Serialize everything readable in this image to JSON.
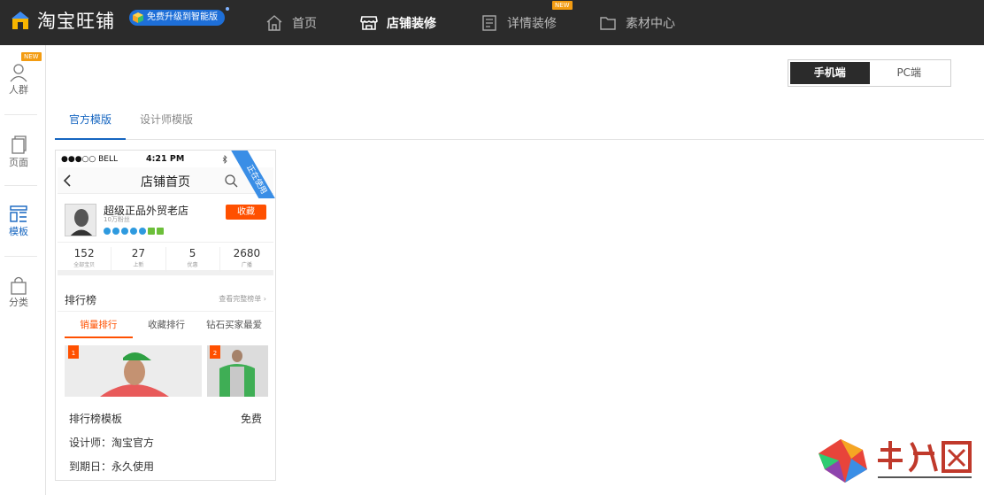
{
  "app": {
    "logo_text": "淘宝旺铺",
    "upgrade_label": "免费升级到智能版"
  },
  "nav": {
    "items": [
      {
        "label": "首页",
        "icon": "home-icon"
      },
      {
        "label": "店铺装修",
        "icon": "store-icon",
        "active": true
      },
      {
        "label": "详情装修",
        "icon": "document-icon",
        "badge": "NEW"
      },
      {
        "label": "素材中心",
        "icon": "folder-icon"
      }
    ]
  },
  "sidebar": {
    "items": [
      {
        "label": "人群",
        "icon": "person-icon",
        "badge": "NEW"
      },
      {
        "label": "页面",
        "icon": "page-icon"
      },
      {
        "label": "模板",
        "icon": "template-icon",
        "active": true
      },
      {
        "label": "分类",
        "icon": "bag-icon"
      }
    ]
  },
  "device_toggle": {
    "mobile": "手机端",
    "pc": "PC端",
    "selected": "手机端"
  },
  "tabs": [
    {
      "label": "官方模版",
      "active": true
    },
    {
      "label": "设计师模版"
    }
  ],
  "template_card": {
    "ribbon": "正在使用",
    "phone": {
      "carrier": "●●●○○ BELL",
      "time": "4:21 PM",
      "page_title": "店铺首页",
      "shop_name": "超级正品外贸老店",
      "fans": "10万粉丝",
      "favorite_button": "收藏",
      "stats": [
        {
          "value": "152",
          "label": "全部宝贝"
        },
        {
          "value": "27",
          "label": "上新"
        },
        {
          "value": "5",
          "label": "优惠"
        },
        {
          "value": "2680",
          "label": "广播"
        }
      ],
      "ranking_title": "排行榜",
      "ranking_more": "查看完整榜单",
      "ranking_tabs": [
        "销量排行",
        "收藏排行",
        "钻石买家最爱"
      ],
      "products": [
        {
          "rank": "1"
        },
        {
          "rank": "2"
        }
      ]
    },
    "name": "排行榜模板",
    "price": "免费",
    "designer": "设计师：淘宝官方",
    "expiry": "到期日：永久使用"
  },
  "colors": {
    "topbar": "#2b2b2b",
    "accent_blue": "#1565c0",
    "accent_orange": "#ff5000",
    "badge_orange": "#f39c12"
  }
}
